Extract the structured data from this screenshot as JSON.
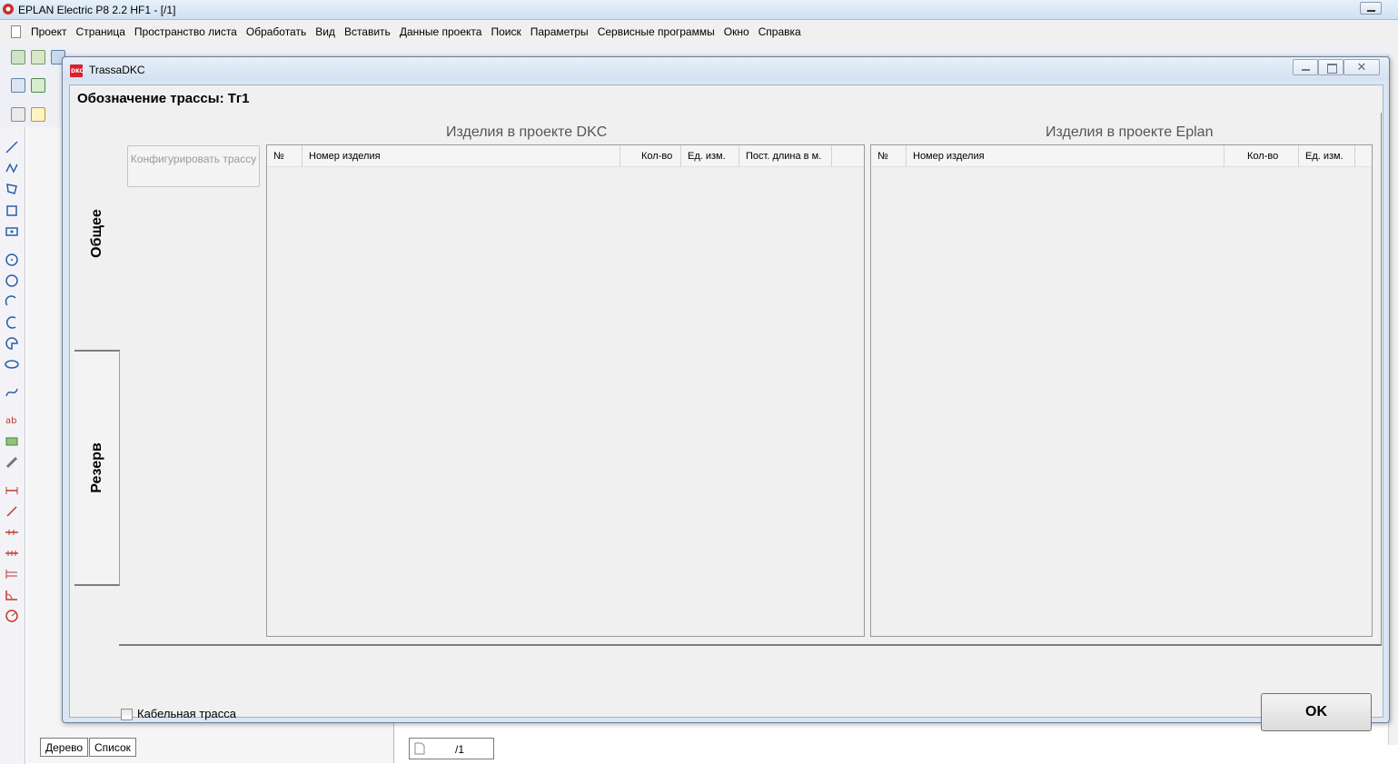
{
  "app": {
    "title": "EPLAN Electric P8 2.2 HF1 - [/1]",
    "menu": [
      "Проект",
      "Страница",
      "Пространство листа",
      "Обработать",
      "Вид",
      "Вставить",
      "Данные проекта",
      "Поиск",
      "Параметры",
      "Сервисные программы",
      "Окно",
      "Справка"
    ]
  },
  "side_panel": {
    "tabs": [
      "Дерево",
      "Список"
    ]
  },
  "status": {
    "page_tab": "/1"
  },
  "dialog": {
    "title": "TrassaDKC",
    "route_label": "Обозначение трассы: Тг1",
    "tabs": [
      "Общее",
      "Резерв"
    ],
    "config_button": "Конфигурировать трассу",
    "dkc_group": {
      "title": "Изделия в проекте DKC",
      "columns": [
        "№",
        "Номер изделия",
        "Кол-во",
        "Ед. изм.",
        "Пост. длина в м."
      ]
    },
    "eplan_group": {
      "title": "Изделия в проекте Eplan",
      "columns": [
        "№",
        "Номер изделия",
        "Кол-во",
        "Ед. изм."
      ]
    },
    "cable_route_checkbox": "Кабельная трасса",
    "cable_route_checked": false,
    "ok_button": "OK"
  },
  "colors": {
    "dialog_frame": "#dbe6f4",
    "dkc_logo": "#d6202c",
    "disabled_text": "#9a9a9a"
  }
}
